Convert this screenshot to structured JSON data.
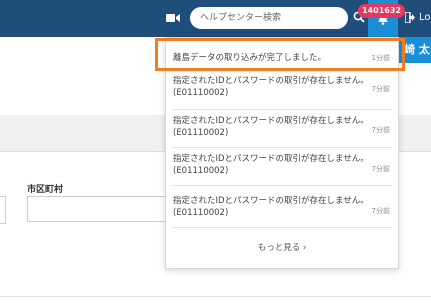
{
  "header": {
    "search_placeholder": "ヘルプセンター検索",
    "notification_badge": "1401632",
    "logout_label": "Lo",
    "user_name": "崎 太"
  },
  "form": {
    "city_label": "市区町村"
  },
  "notifications": {
    "items": [
      {
        "text": "離島データの取り込みが完了しました。",
        "time": "1分前"
      },
      {
        "text_line1": "指定されたIDとパスワードの取引が存在しません。",
        "text_line2": "(E01110002)",
        "time": "7分前"
      },
      {
        "text_line1": "指定されたIDとパスワードの取引が存在しません。",
        "text_line2": "(E01110002)",
        "time": "7分前"
      },
      {
        "text_line1": "指定されたIDとパスワードの取引が存在しません。",
        "text_line2": "(E01110002)",
        "time": "7分前"
      },
      {
        "text_line1": "指定されたIDとパスワードの取引が存在しません。",
        "text_line2": "(E01110002)",
        "time": "7分前"
      }
    ],
    "more_label": "もっと見る ›"
  },
  "colors": {
    "topbar": "#1f4e7a",
    "accent": "#1a8fd6",
    "badge": "#e8365d",
    "highlight": "#f47b20"
  },
  "icons": [
    "video-icon",
    "search-icon",
    "bell-icon",
    "logout-icon"
  ]
}
